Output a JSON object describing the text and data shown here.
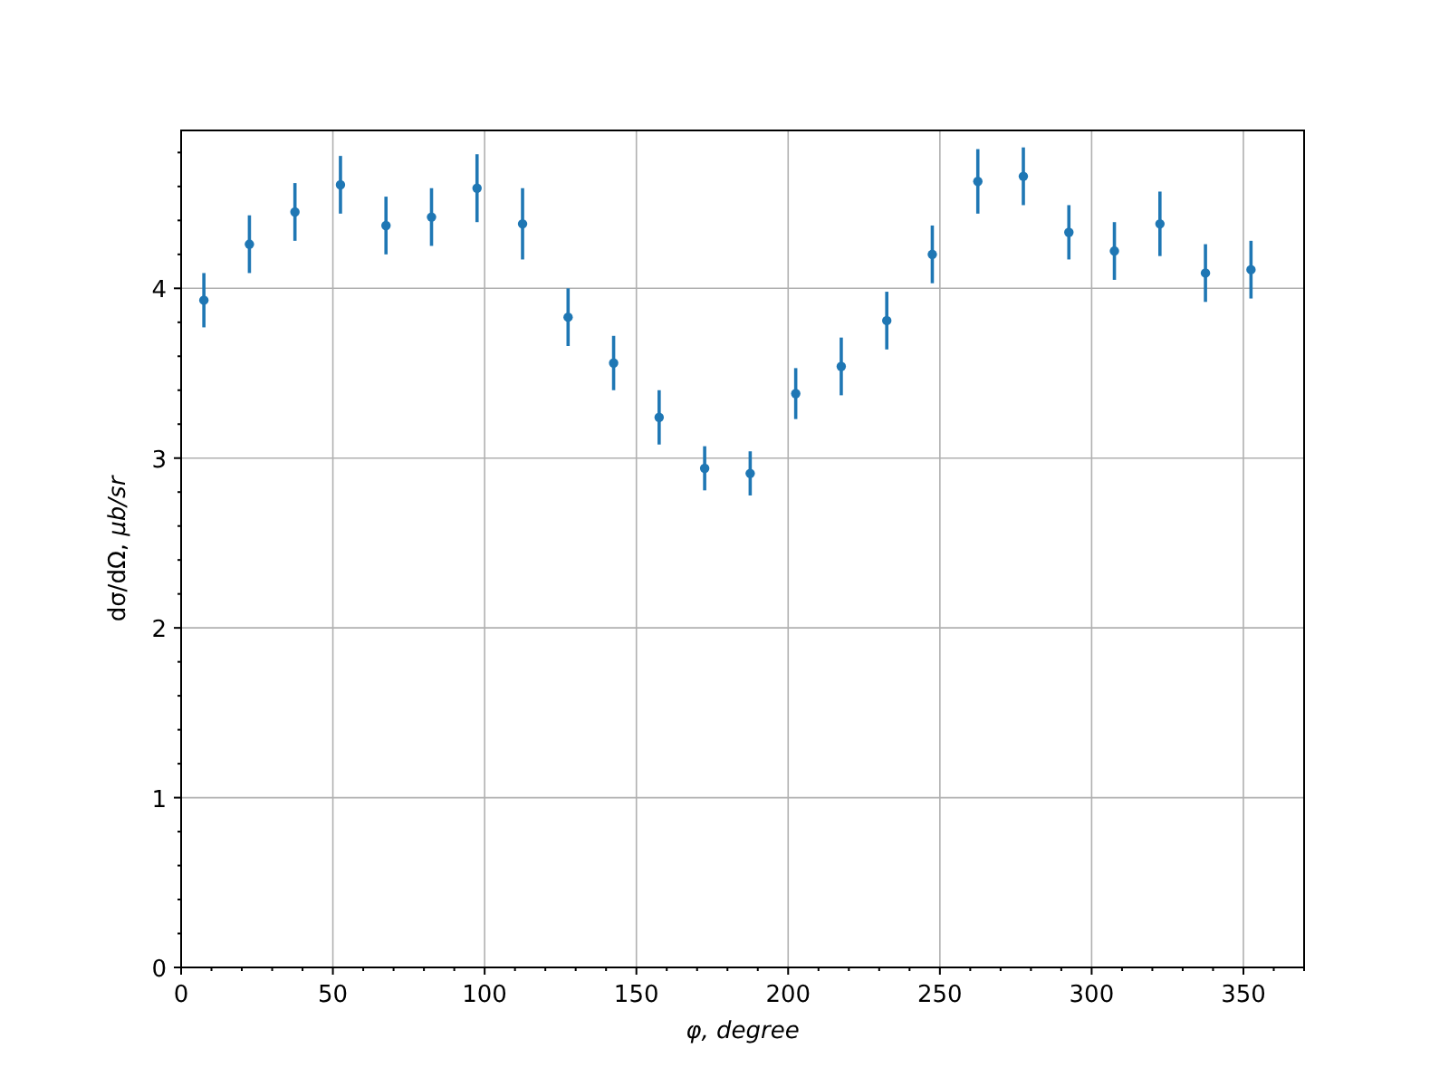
{
  "chart_data": {
    "type": "scatter",
    "xlabel": "φ, degree",
    "ylabel": "dσ/dΩ, *μb/sr*",
    "grid": true,
    "x": [
      7.5,
      22.5,
      37.5,
      52.5,
      67.5,
      82.5,
      97.5,
      112.5,
      127.5,
      142.5,
      157.5,
      172.5,
      187.5,
      202.5,
      217.5,
      232.5,
      247.5,
      262.5,
      277.5,
      292.5,
      307.5,
      322.5,
      337.5,
      352.5
    ],
    "series": [
      {
        "color": "#1f77b4",
        "values": [
          3.93,
          4.26,
          4.45,
          4.61,
          4.37,
          4.42,
          4.59,
          4.38,
          3.83,
          3.56,
          3.24,
          2.94,
          2.91,
          3.38,
          3.54,
          3.81,
          4.2,
          4.63,
          4.66,
          4.33,
          4.22,
          4.38,
          4.09,
          4.11
        ],
        "errors": [
          0.16,
          0.17,
          0.17,
          0.17,
          0.17,
          0.17,
          0.2,
          0.21,
          0.17,
          0.16,
          0.16,
          0.13,
          0.13,
          0.15,
          0.17,
          0.17,
          0.17,
          0.19,
          0.17,
          0.16,
          0.17,
          0.19,
          0.17,
          0.17
        ]
      }
    ],
    "xlim": [
      0,
      370
    ],
    "ylim": [
      0,
      4.93
    ],
    "xticks": [
      0,
      50,
      100,
      150,
      200,
      250,
      300,
      350
    ],
    "yticks": [
      0,
      1,
      2,
      3,
      4
    ]
  }
}
